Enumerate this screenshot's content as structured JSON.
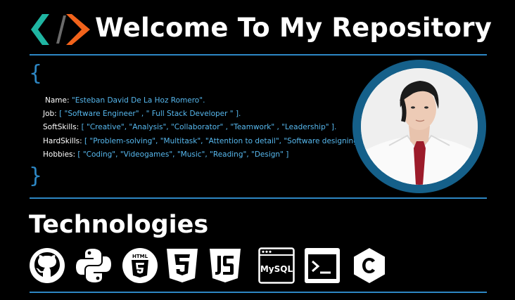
{
  "header": {
    "title": "Welcome To My Repository",
    "logo_icon": "code-brackets-logo"
  },
  "profile": {
    "open_brace": "{",
    "close_brace": "}",
    "fields": [
      {
        "key": "Name:",
        "value": "\"Esteban David  De La Hoz Romero\"."
      },
      {
        "key": "Job:",
        "value": "[ \"Software Engineer\" , \" Full Stack Developer \" ]."
      },
      {
        "key": "SoftSkills:",
        "value": "[ \"Creative\",  \"Analysis\", \"Collaborator\" ,  \"Teamwork\" , \"Leadership\" ]."
      },
      {
        "key": "HardSkills:",
        "value": "[ \"Problem-solving\", \"Multitask\", \"Attention to detail\", \"Software designing\" ]"
      },
      {
        "key": "Hobbies:",
        "value": "[ \"Coding\", \"Videogames\", \"Music\",  \"Reading\", \"Design\" ]"
      }
    ]
  },
  "technologies": {
    "title": "Technologies",
    "icons": [
      "github-icon",
      "python-icon",
      "html5-icon",
      "css3-icon",
      "javascript-icon",
      "mysql-icon",
      "terminal-icon",
      "c-language-icon"
    ],
    "html_label": "HTML",
    "mysql_label": "MySQL"
  },
  "colors": {
    "accent_blue": "#2d87c4",
    "value_blue": "#57b8ee",
    "logo_teal": "#1fb5a2",
    "logo_orange": "#f2631b",
    "avatar_ring": "#15608a"
  }
}
